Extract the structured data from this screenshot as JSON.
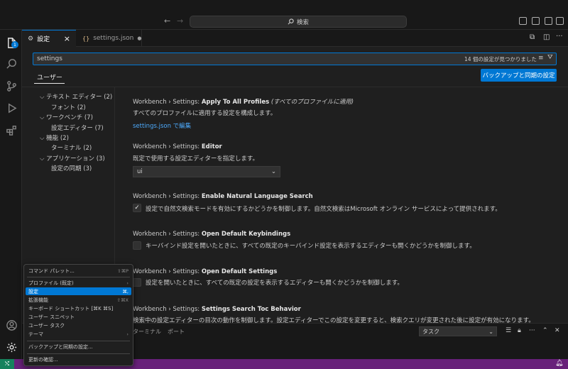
{
  "titlebar": {
    "search_placeholder": "検索",
    "search_icon": "search-icon"
  },
  "tabs": [
    {
      "label": "設定",
      "icon": "settings-file-icon",
      "close": "×"
    },
    {
      "label": "settings.json",
      "icon": "json-icon",
      "dirty_dot": "●"
    }
  ],
  "search": {
    "value": "settings",
    "result_count": "14 個の設定が見つかりました"
  },
  "scope_tab": "ユーザー",
  "sync_button": "バックアップと同期の設定",
  "toc": [
    {
      "label": "テキスト エディター (2)",
      "expanded": true
    },
    {
      "label": "フォント (2)"
    },
    {
      "label": "ワークベンチ (7)",
      "expanded": true
    },
    {
      "label": "設定エディター (7)"
    },
    {
      "label": "機能 (2)",
      "expanded": true
    },
    {
      "label": "ターミナル (2)"
    },
    {
      "label": "アプリケーション (3)",
      "expanded": true
    },
    {
      "label": "設定の同期 (3)"
    }
  ],
  "settings": [
    {
      "prefix": "Workbench › Settings: ",
      "name": "Apply To All Profiles",
      "tag": "(すべてのプロファイルに適用)",
      "desc": "すべてのプロファイルに適用する設定を構成します。",
      "link": "settings.json で編集"
    },
    {
      "prefix": "Workbench › Settings: ",
      "name": "Editor",
      "desc": "既定で使用する設定エディターを指定します。",
      "select_value": "ui"
    },
    {
      "prefix": "Workbench › Settings: ",
      "name": "Enable Natural Language Search",
      "desc": "設定で自然文検索モードを有効にするかどうかを制御します。自然文検索はMicrosoft オンライン サービスによって提供されます。",
      "checked": true
    },
    {
      "prefix": "Workbench › Settings: ",
      "name": "Open Default Keybindings",
      "desc": "キーバインド設定を開いたときに、すべての既定のキーバインド設定を表示するエディターも開くかどうかを制御します。",
      "checked": false
    },
    {
      "prefix": "Workbench › Settings: ",
      "name": "Open Default Settings",
      "desc": "設定を開いたときに、すべての既定の設定を表示するエディターも開くかどうかを制御します。",
      "checked": false
    },
    {
      "prefix": "Workbench › Settings: ",
      "name": "Settings Search Toc Behavior",
      "desc": "検索中の設定エディターの目次の動作を制御します。設定エディターでこの設定を変更すると、検索クエリが変更された後に設定が有効になります。"
    }
  ],
  "panel": {
    "tabs": [
      "ターミナル",
      "ポート"
    ],
    "task_select": "タスク"
  },
  "menu": {
    "items": [
      {
        "label": "コマンド パレット...",
        "key": "⇧⌘P"
      },
      {
        "label": "プロファイル (既定)",
        "submenu": "›"
      },
      {
        "label": "設定",
        "key": "⌘,",
        "selected": true
      },
      {
        "label": "拡張機能",
        "key": "⇧⌘X"
      },
      {
        "label": "キーボード ショートカット [⌘K ⌘S]",
        "key": ""
      },
      {
        "label": "ユーザー スニペット",
        "key": ""
      },
      {
        "label": "ユーザー タスク",
        "key": ""
      },
      {
        "label": "テーマ",
        "submenu": "›"
      },
      {
        "label": "バックアップと同期の設定...",
        "key": ""
      },
      {
        "label": "更新の確認...",
        "key": ""
      }
    ]
  },
  "activity_badge": "1",
  "colors": {
    "accent": "#0078d4",
    "statusbar": "#68217a",
    "remote": "#16825d",
    "link": "#4daafc"
  }
}
